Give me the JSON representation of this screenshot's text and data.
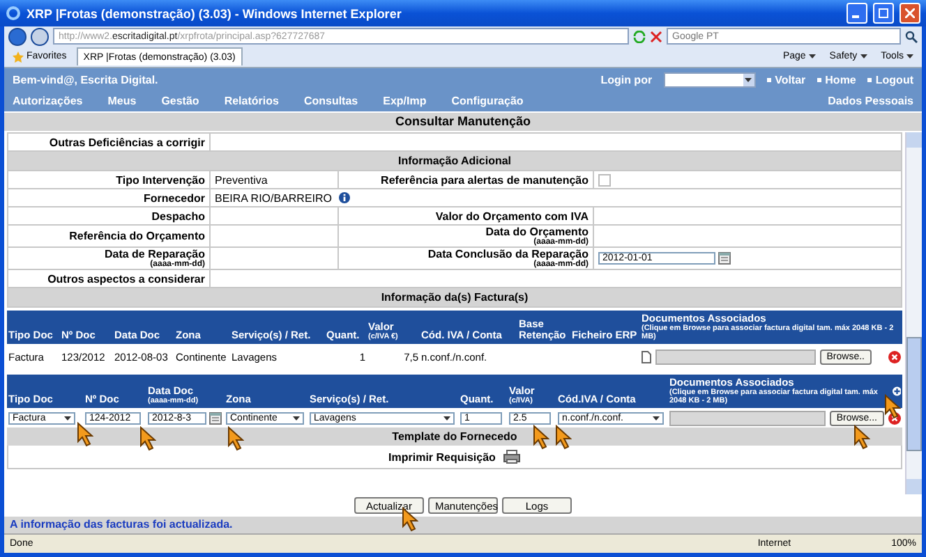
{
  "window": {
    "title": "XRP |Frotas (demonstração) (3.03) - Windows Internet Explorer"
  },
  "browser": {
    "address": {
      "prefix": "http://www2.",
      "domain": "escritadigital.pt",
      "path": "/xrpfrota/principal.asp?627727687"
    },
    "search_placeholder": "Google PT",
    "favorites": "Favorites",
    "tab": "XRP |Frotas (demonstração) (3.03)",
    "tools": [
      "Page",
      "Safety",
      "Tools"
    ]
  },
  "header": {
    "welcome": "Bem-vind@, Escrita Digital.",
    "login_label": "Login por",
    "links": [
      "Voltar",
      "Home",
      "Logout"
    ],
    "menu": [
      "Autorizações",
      "Meus",
      "Gestão",
      "Relatórios",
      "Consultas",
      "Exp/Imp",
      "Configuração"
    ],
    "personal": "Dados Pessoais"
  },
  "page_title": "Consultar Manutenção",
  "details": {
    "top_rows": [
      {
        "label": "Outras Deficiências a corrigir"
      }
    ],
    "section_title": "Informação Adicional",
    "rows": [
      {
        "label": "Tipo Intervenção",
        "value": "Preventiva",
        "right": {
          "kind": "checkbox",
          "label": "Referência para alertas de manutenção",
          "checked": false
        }
      },
      {
        "label": "Fornecedor",
        "value": "BEIRA RIO/BARREIRO",
        "info_icon": true
      },
      {
        "label": "Despacho",
        "right": {
          "kind": "text",
          "label": "Valor do Orçamento com IVA"
        }
      },
      {
        "label": "Referência do Orçamento",
        "right": {
          "kind": "text",
          "label": "Data do Orçamento",
          "hint": "(aaaa-mm-dd)"
        }
      },
      {
        "label": "Data de Reparação",
        "hint": "(aaaa-mm-dd)",
        "right": {
          "kind": "date",
          "label": "Data Conclusão da Reparação",
          "hint": "(aaaa-mm-dd)",
          "value": "2012-01-01"
        }
      }
    ],
    "bottom_rows": [
      {
        "label": "Outros aspectos a considerar"
      }
    ]
  },
  "invoices": {
    "title": "Informação da(s) Factura(s)",
    "columns": [
      {
        "label": "Tipo Doc"
      },
      {
        "label": "Nº Doc"
      },
      {
        "label": "Data Doc"
      },
      {
        "label": "Zona"
      },
      {
        "label": "Serviço(s) / Ret."
      },
      {
        "label": "Quant."
      },
      {
        "label": "Valor",
        "sub": "(c/IVA €)"
      },
      {
        "label": "Cód. IVA / Conta"
      },
      {
        "label": "Base Retenção"
      },
      {
        "label": "Ficheiro ERP"
      },
      {
        "label": "Documentos Associados",
        "sub": "(Clique em Browse para associar factura digital tam. máx 2048 KB - 2 MB)"
      }
    ],
    "rows": [
      {
        "cells": [
          "Factura",
          "123/2012",
          "2012-08-03",
          "Continente",
          "Lavagens",
          "1",
          "7,5",
          "n.conf./n.conf."
        ],
        "browse": "Browse.."
      }
    ]
  },
  "new_invoice": {
    "columns": [
      {
        "label": "Tipo Doc"
      },
      {
        "label": "Nº Doc"
      },
      {
        "label": "Data Doc",
        "sub": "(aaaa-mm-dd)"
      },
      {
        "label": "Zona"
      },
      {
        "label": "Serviço(s) / Ret."
      },
      {
        "label": "Quant."
      },
      {
        "label": "Valor",
        "sub": "(c/IVA)"
      },
      {
        "label": "Cód.IVA / Conta"
      },
      {
        "label": "Documentos Associados",
        "sub": "(Clique em Browse para associar factura digital tam. máx 2048 KB - 2 MB)"
      }
    ],
    "fields": [
      {
        "kind": "select",
        "value": "Factura"
      },
      {
        "kind": "input",
        "value": "124-2012"
      },
      {
        "kind": "date",
        "value": "2012-8-3"
      },
      {
        "kind": "select",
        "value": "Continente"
      },
      {
        "kind": "select",
        "value": "Lavagens"
      },
      {
        "kind": "input",
        "value": "1"
      },
      {
        "kind": "input",
        "value": "2.5"
      },
      {
        "kind": "select",
        "value": "n.conf./n.conf."
      },
      {
        "kind": "file",
        "button": "Browse..."
      }
    ]
  },
  "template": {
    "title": "Template do Fornecedo",
    "print_label": "Imprimir Requisição"
  },
  "buttons": [
    "Actualizar",
    "Manutenções",
    "Logs"
  ],
  "message": "A informação das facturas foi actualizada.",
  "status_bar": {
    "text": "Done",
    "zone": "Internet",
    "zoom": "100%"
  }
}
